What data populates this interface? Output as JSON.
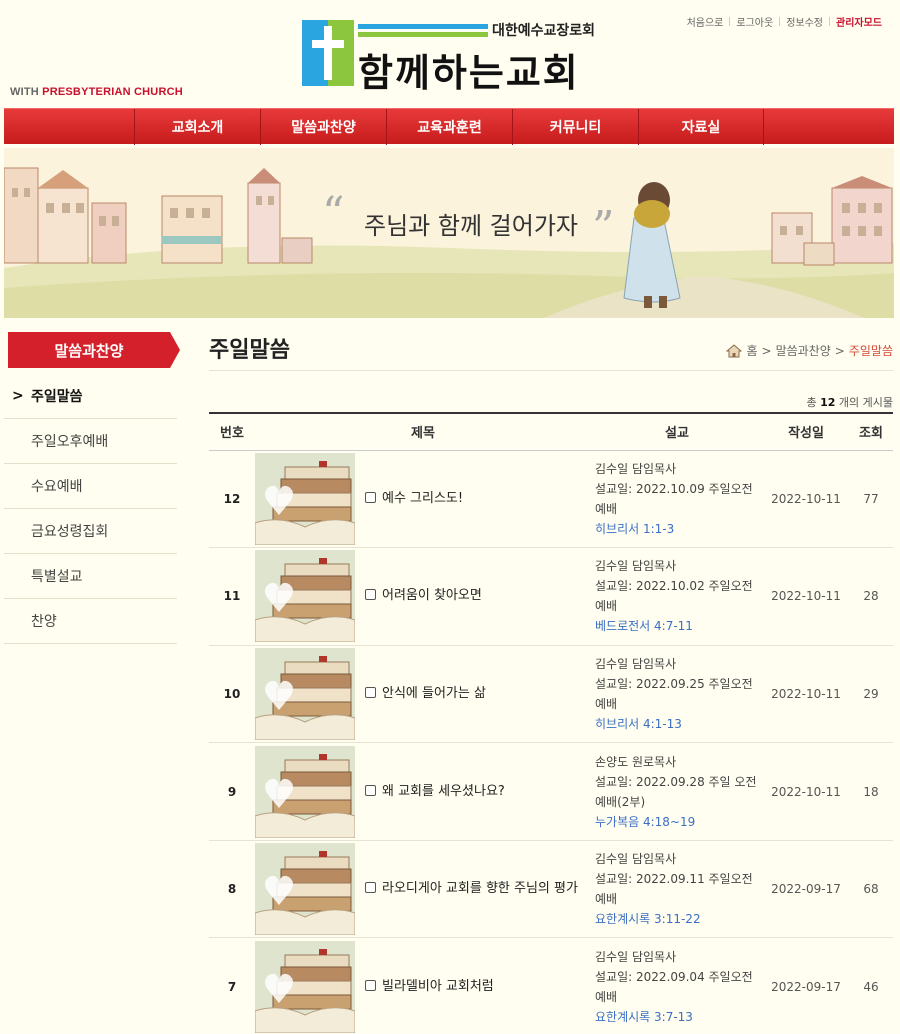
{
  "header": {
    "with_prefix": "WITH ",
    "with_brand": "PRESBYTERIAN CHURCH",
    "logo_sub": "대한예수교장로회",
    "logo_title": "함께하는교회",
    "util_links": [
      "처음으로",
      "로그아웃",
      "정보수정",
      "관리자모드"
    ]
  },
  "nav": {
    "items": [
      "교회소개",
      "말씀과찬양",
      "교육과훈련",
      "커뮤니티",
      "자료실"
    ]
  },
  "banner": {
    "slogan": "주님과 함께 걸어가자",
    "quote_open": "“",
    "quote_close": "”"
  },
  "sidebar": {
    "heading": "말씀과찬양",
    "items": [
      "주일말씀",
      "주일오후예배",
      "수요예배",
      "금요성령집회",
      "특별설교",
      "찬양"
    ],
    "active_chevron": ">"
  },
  "content": {
    "title": "주일말씀",
    "breadcrumb": {
      "home": "홈",
      "sep": ">",
      "section": "말씀과찬양",
      "current": "주일말씀"
    },
    "total_prefix": "총",
    "total_count": "12",
    "total_suffix": "개의 게시물",
    "columns": [
      "번호",
      "제목",
      "설교",
      "작성일",
      "조회"
    ]
  },
  "posts": [
    {
      "num": "12",
      "title": "예수 그리스도!",
      "preacher": "김수일 담임목사",
      "sermon_line": "설교일: 2022.10.09 주일오전예배",
      "ref": "히브리서 1:1-3",
      "date": "2022-10-11",
      "views": "77"
    },
    {
      "num": "11",
      "title": "어려움이 찾아오면",
      "preacher": "김수일 담임목사",
      "sermon_line": "설교일: 2022.10.02 주일오전예배",
      "ref": "베드로전서 4:7-11",
      "date": "2022-10-11",
      "views": "28"
    },
    {
      "num": "10",
      "title": "안식에 들어가는 삶",
      "preacher": "김수일 담임목사",
      "sermon_line": "설교일: 2022.09.25 주일오전예배",
      "ref": "히브리서 4:1-13",
      "date": "2022-10-11",
      "views": "29"
    },
    {
      "num": "9",
      "title": "왜 교회를 세우셨나요?",
      "preacher": "손양도 원로목사",
      "sermon_line": "설교일: 2022.09.28 주일 오전예배(2부)",
      "ref": "누가복음 4:18~19",
      "date": "2022-10-11",
      "views": "18"
    },
    {
      "num": "8",
      "title": "라오디게아 교회를 향한 주님의 평가",
      "preacher": "김수일 담임목사",
      "sermon_line": "설교일: 2022.09.11 주일오전예배",
      "ref": "요한계시록 3:11-22",
      "date": "2022-09-17",
      "views": "68"
    },
    {
      "num": "7",
      "title": "빌라델비아 교회처럼",
      "preacher": "김수일 담임목사",
      "sermon_line": "설교일: 2022.09.04 주일오전예배",
      "ref": "요한계시록 3:7-13",
      "date": "2022-09-17",
      "views": "46"
    }
  ]
}
